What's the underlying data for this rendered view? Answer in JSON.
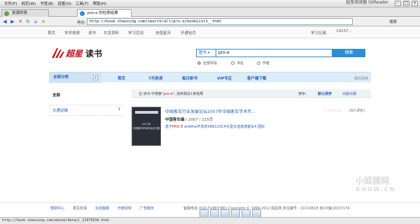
{
  "browser": {
    "menus": [
      "文件(F)",
      "网页(W)",
      "书签(B)",
      "设置(O)",
      "工具(T)",
      "帮助(H)"
    ],
    "window_title": "超星阅读器 SSReader",
    "tabs": [
      {
        "label": "资源列表"
      },
      {
        "label": "pro-e 的检索结果"
      }
    ],
    "address_label": "地址:",
    "address": "http://book.chaoxing.com/search/all/pro-e/bookList1__html",
    "search_label": "搜索",
    "status_url": "http://book.chaoxing.com/ebook/detail_11975634.html"
  },
  "site_nav": {
    "items": [
      "首页",
      "学术视频",
      "读书",
      "共享资料",
      "学习空间",
      "充值星币",
      "开通包月"
    ],
    "study_memory": "学习记录",
    "user": "19237..."
  },
  "logo": {
    "brand": "超星",
    "product": "读书"
  },
  "search": {
    "type": "图书",
    "query": "pro-e",
    "button": "搜索",
    "options": [
      {
        "label": "全部字段"
      },
      {
        "label": "书名"
      },
      {
        "label": "作者"
      }
    ]
  },
  "category_bar": {
    "all_label": "全部分类",
    "items": [
      "首页",
      "7天热读",
      "每日新书",
      "VIP专区",
      "客户端下载"
    ],
    "history": "我的阅读"
  },
  "left_panel": {
    "title": "全部",
    "items": [
      {
        "label": "交通运输",
        "count": "1"
      }
    ]
  },
  "results": {
    "prefix": "在 读书 中搜索",
    "query": "\"pro-e\"",
    "suffix": ", 找到相关1条结果",
    "sort_label": "排序：",
    "sort_default": "默认排序",
    "sort_date": "出版日期",
    "items": [
      {
        "title": "中国客车行业发展论坛2007年中国客车学术年...",
        "author": "中国客车编",
        "year_pages": " / 2007 / 215页",
        "snippet_prefix": "基于",
        "snippet_highlight": "PRO-E",
        "snippet_rest": " wildfire开发的SRB123CH大型长途旅游客车4 国际",
        "stars": "☆☆☆☆☆",
        "reviews": "(0人评价)",
        "cover_line1": "2007年",
        "cover_line2": "中国客车学术年会论文集"
      }
    ]
  },
  "footer": {
    "links": [
      "帮助中心",
      "意见反馈",
      "在线客服",
      "作者授权",
      "广告服务"
    ],
    "copyright": "客服电话 (010-51665380) Copyright © 1999-2012 超星网 单位编号：11010818 京ICP备10037174"
  },
  "watermark": {
    "text": "小狐狸网",
    "sub": "XHOW.CN"
  },
  "colors": {
    "accent": "#2c8fd6",
    "link": "#2a62b8",
    "brand_red": "#c4161c"
  }
}
